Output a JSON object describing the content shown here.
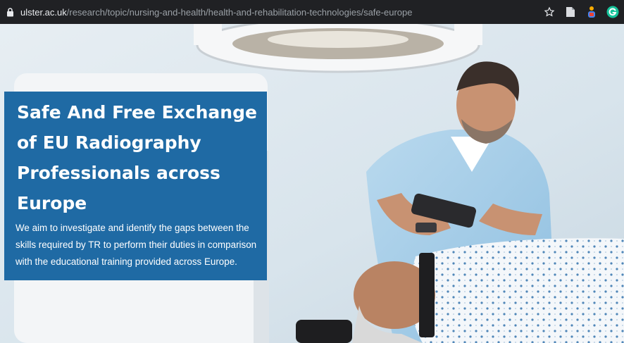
{
  "browser": {
    "url_host": "ulster.ac.uk",
    "url_path": "/research/topic/nursing-and-health/health-and-rehabilitation-technologies/safe-europe",
    "icons": [
      "lock-icon",
      "star-icon",
      "document-icon",
      "extension-icon",
      "grammarly-icon"
    ]
  },
  "hero": {
    "title": "Safe And Free Exchange of EU Radiography Professionals across Europe",
    "description": "We aim to investigate and identify the gaps between the skills required by TR to perform their duties in comparison with the educational training provided across Europe.",
    "panel_color": "#1f6aa4",
    "image_subject": "radiographer-positioning-patient-photo"
  }
}
